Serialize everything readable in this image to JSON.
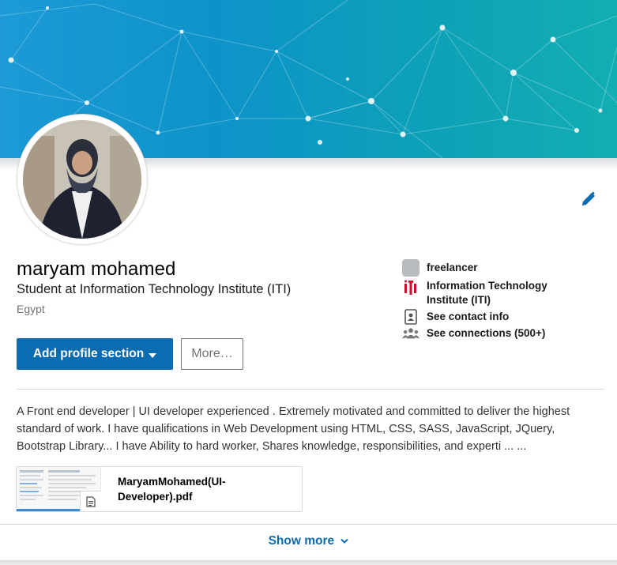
{
  "profile": {
    "name": "maryam mohamed",
    "headline": "Student at Information Technology Institute (ITI)",
    "location": "Egypt"
  },
  "actions": {
    "add_section_label": "Add profile section",
    "more_label": "More…"
  },
  "side_info": {
    "company": "freelancer",
    "education": "Information Technology Institute (ITI)",
    "contact": "See contact info",
    "connections": "See connections (500+)"
  },
  "summary": {
    "text": "A Front end developer | UI developer experienced . Extremely motivated and committed to deliver the highest standard of work. I have qualifications in Web Development using HTML, CSS, SASS, JavaScript, JQuery, Bootstrap Library... I have Ability to hard worker, Shares knowledge, responsibilities, and experti ... ..."
  },
  "document": {
    "title": "MaryamMohamed(UI-Developer).pdf"
  },
  "footer": {
    "show_more_label": "Show more"
  },
  "icons": {
    "edit": "pencil-icon",
    "company": "company-placeholder-icon",
    "education": "iti-logo-icon",
    "contact": "contact-card-icon",
    "connections": "people-icon",
    "document": "document-icon",
    "show_more": "chevron-down-icon"
  },
  "colors": {
    "primary": "#0b6cb2",
    "banner_start": "#1d9ad6",
    "banner_end": "#12aeb2"
  }
}
